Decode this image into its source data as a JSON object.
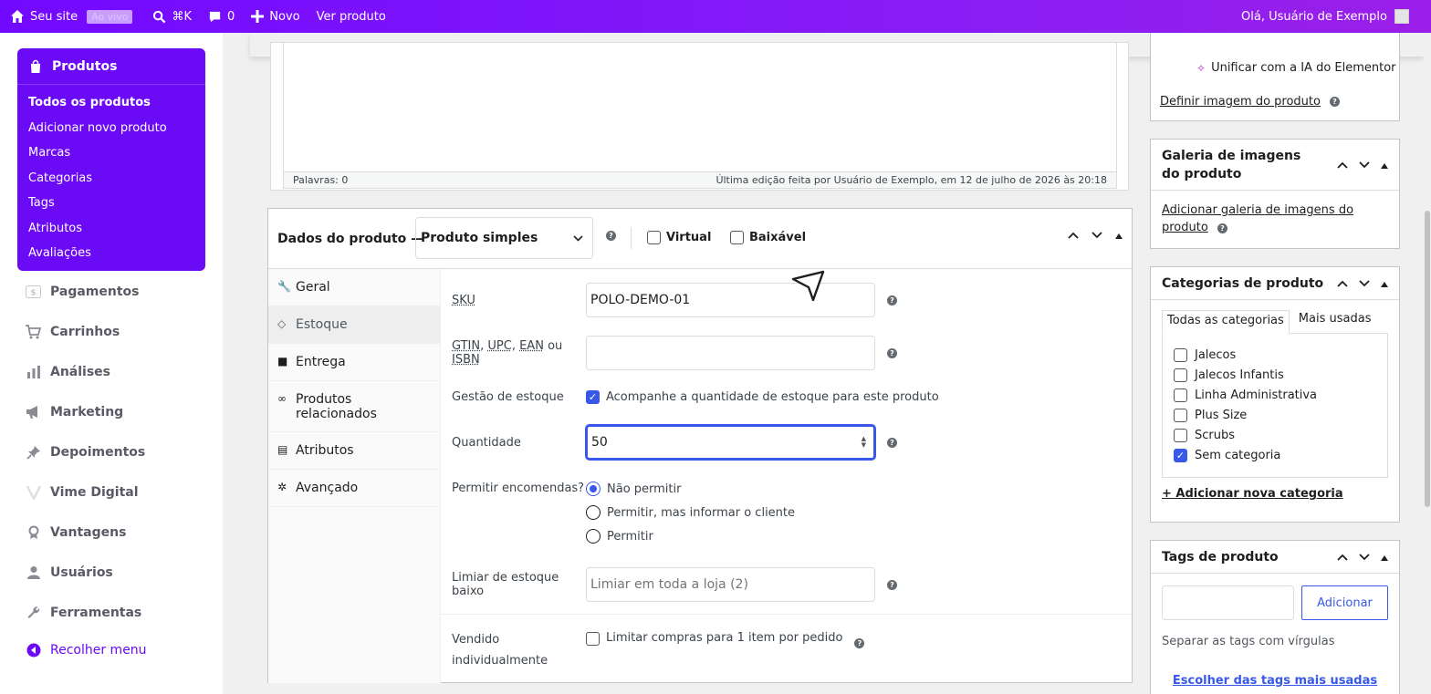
{
  "colors": {
    "topbar_start": "#7209ff",
    "accent": "#6b0af4",
    "focus": "#3858e9"
  },
  "topbar": {
    "site_label": "Seu site",
    "live_label": "Ao vivo",
    "search_shortcut": "⌘K",
    "comments_count": "0",
    "new_label": "Novo",
    "view_product_label": "Ver produto",
    "greeting": "Olá, Usuário de Exemplo"
  },
  "sidebar": {
    "products_menu": {
      "title": "Produtos",
      "items": [
        "Todos os produtos",
        "Adicionar novo produto",
        "Marcas",
        "Categorias",
        "Tags",
        "Atributos",
        "Avaliações"
      ]
    },
    "items": [
      {
        "label": "Pagamentos",
        "icon": "payments-icon"
      },
      {
        "label": "Carrinhos",
        "icon": "cart-icon"
      },
      {
        "label": "Análises",
        "icon": "bar-chart-icon"
      },
      {
        "label": "Marketing",
        "icon": "megaphone-icon"
      },
      {
        "label": "Depoimentos",
        "icon": "pin-icon"
      },
      {
        "label": "Vime Digital",
        "icon": "v-logo-icon"
      },
      {
        "label": "Vantagens",
        "icon": "award-icon"
      },
      {
        "label": "Usuários",
        "icon": "user-icon"
      },
      {
        "label": "Ferramentas",
        "icon": "wrench-icon"
      }
    ],
    "collapse_label": "Recolher menu"
  },
  "editor": {
    "word_count": "Palavras: 0",
    "last_edit": "Última edição feita por Usuário de Exemplo, em 12 de julho de 2026 às 20:18"
  },
  "product_data": {
    "title": "Dados do produto —",
    "type_selected": "Produto simples",
    "virtual_label": "Virtual",
    "downloadable_label": "Baixável",
    "tabs": [
      "Geral",
      "Estoque",
      "Entrega",
      "Produtos relacionados",
      "Atributos",
      "Avançado"
    ],
    "active_tab": "Estoque",
    "inventory": {
      "sku_label": "SKU",
      "sku_value": "POLO-DEMO-01",
      "gtin_abbr1": "GTIN",
      "gtin_abbr2": "UPC",
      "gtin_abbr3": "EAN",
      "gtin_or": "ou",
      "gtin_abbr4": "ISBN",
      "gtin_value": "",
      "stock_mgmt_label": "Gestão de estoque",
      "stock_mgmt_text": "Acompanhe a quantidade de estoque para este produto",
      "quantity_label": "Quantidade",
      "quantity_value": "50",
      "backorders_label": "Permitir encomendas?",
      "backorder_options": [
        "Não permitir",
        "Permitir, mas informar o cliente",
        "Permitir"
      ],
      "low_stock_label": "Limiar de estoque baixo",
      "low_stock_placeholder": "Limiar em toda a loja (2)",
      "sold_individually_label_1": "Vendido",
      "sold_individually_label_2": "individualmente",
      "sold_individually_text": "Limitar compras para 1 item por pedido"
    }
  },
  "right": {
    "image_box": {
      "ai_label": "Unificar com a IA do Elementor",
      "set_image_link": "Definir imagem do produto"
    },
    "gallery": {
      "title_1": "Galeria de imagens",
      "title_2": "do produto",
      "link_1": "Adicionar galeria de imagens do",
      "link_2": "produto"
    },
    "categories": {
      "title": "Categorias de produto",
      "tab_all": "Todas as categorias",
      "tab_popular": "Mais usadas",
      "items": [
        {
          "label": "Jalecos",
          "checked": false
        },
        {
          "label": "Jalecos Infantis",
          "checked": false
        },
        {
          "label": "Linha Administrativa",
          "checked": false
        },
        {
          "label": "Plus Size",
          "checked": false
        },
        {
          "label": "Scrubs",
          "checked": false
        },
        {
          "label": "Sem categoria",
          "checked": true
        }
      ],
      "add_link": "+ Adicionar nova categoria"
    },
    "tags": {
      "title": "Tags de produto",
      "add_button": "Adicionar",
      "hint": "Separar as tags com vírgulas",
      "popular_link": "Escolher das tags mais usadas"
    }
  }
}
